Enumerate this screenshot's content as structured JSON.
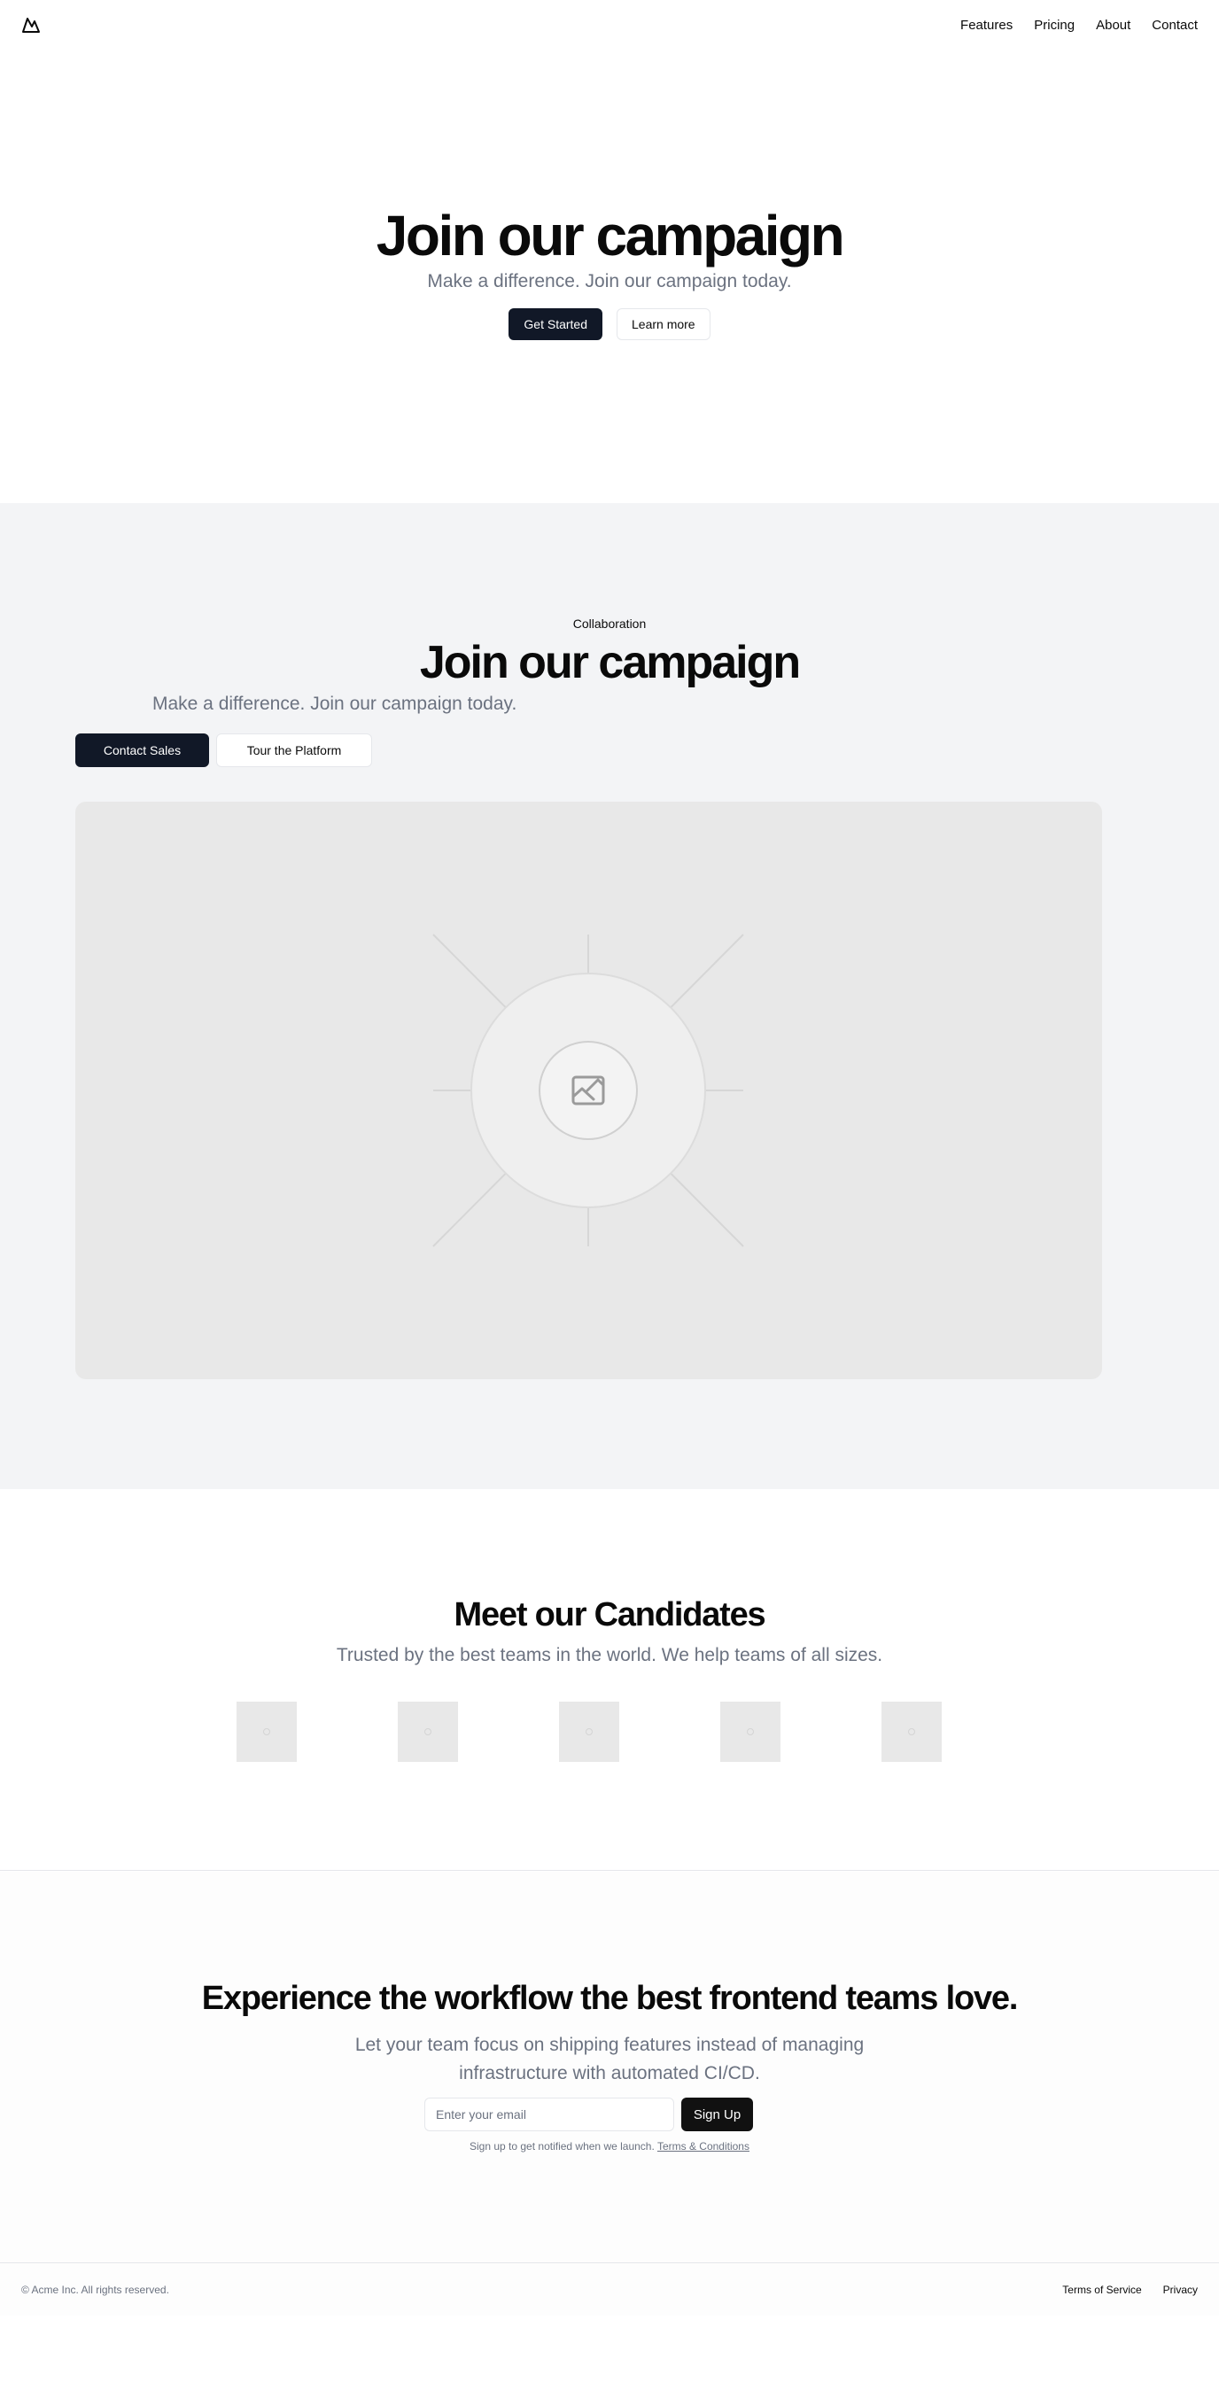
{
  "header": {
    "logo_icon": "mountain-logo-icon",
    "nav": [
      "Features",
      "Pricing",
      "About",
      "Contact"
    ]
  },
  "hero": {
    "title": "Join our campaign",
    "subtitle": "Make a difference. Join our campaign today.",
    "primary_button": "Get Started",
    "secondary_button": "Learn more"
  },
  "feature": {
    "eyebrow": "Collaboration",
    "title": "Join our campaign",
    "subtitle": "Make a difference. Join our campaign today.",
    "primary_button": "Contact Sales",
    "secondary_button": "Tour the Platform",
    "image_icon": "image-placeholder-icon"
  },
  "candidates": {
    "title": "Meet our Candidates",
    "subtitle": "Trusted by the best teams in the world. We help teams of all sizes.",
    "logo_count": 5
  },
  "cta": {
    "title": "Experience the workflow the best frontend teams love.",
    "subtitle": "Let your team focus on shipping features instead of managing infrastructure with automated CI/CD.",
    "email_placeholder": "Enter your email",
    "button": "Sign Up",
    "note": "Sign up to get notified when we launch.",
    "terms_link": "Terms & Conditions"
  },
  "footer": {
    "copyright": "© Acme Inc. All rights reserved.",
    "links": [
      "Terms of Service",
      "Privacy"
    ]
  },
  "colors": {
    "primary_button": "#111827",
    "muted_text": "#6b7280",
    "section_bg": "#f3f4f6",
    "placeholder_bg": "#e8e8e8"
  }
}
